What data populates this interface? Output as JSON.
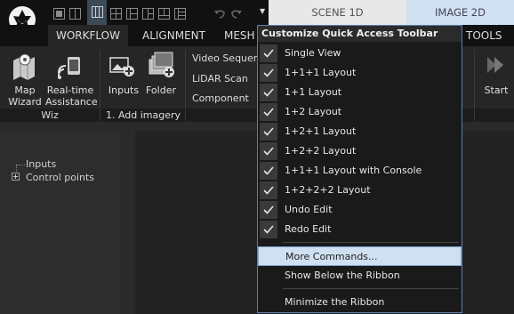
{
  "top_tabs": {
    "scene": "SCENE 1D",
    "image": "IMAGE 2D"
  },
  "ribbon_tabs": [
    "WORKFLOW",
    "ALIGNMENT",
    "MESH M",
    "TOOLS"
  ],
  "ribbon": {
    "map_wizard": "Map\nWizard",
    "realtime": "Real-time\nAssistance",
    "inputs": "Inputs",
    "folder": "Folder",
    "video": "Video Sequen",
    "lidar": "LiDAR Scan",
    "component": "Component",
    "start": "Start",
    "group_wiz": "Wiz",
    "group_add": "1. Add imagery"
  },
  "tree": {
    "inputs": "Inputs",
    "control_points": "Control points"
  },
  "menu": {
    "title": "Customize Quick Access Toolbar",
    "checked_items": [
      "Single View",
      "1+1+1 Layout",
      "1+1 Layout",
      "1+2 Layout",
      "1+2+1 Layout",
      "1+2+2 Layout",
      "1+1+1 Layout with Console",
      "1+2+2+2 Layout",
      "Undo Edit",
      "Redo Edit"
    ],
    "more": "More Commands...",
    "show_below": "Show Below the Ribbon",
    "minimize": "Minimize the Ribbon"
  },
  "colors": {
    "accent_border": "#5a7fa8",
    "highlight": "#cfe0f2"
  }
}
